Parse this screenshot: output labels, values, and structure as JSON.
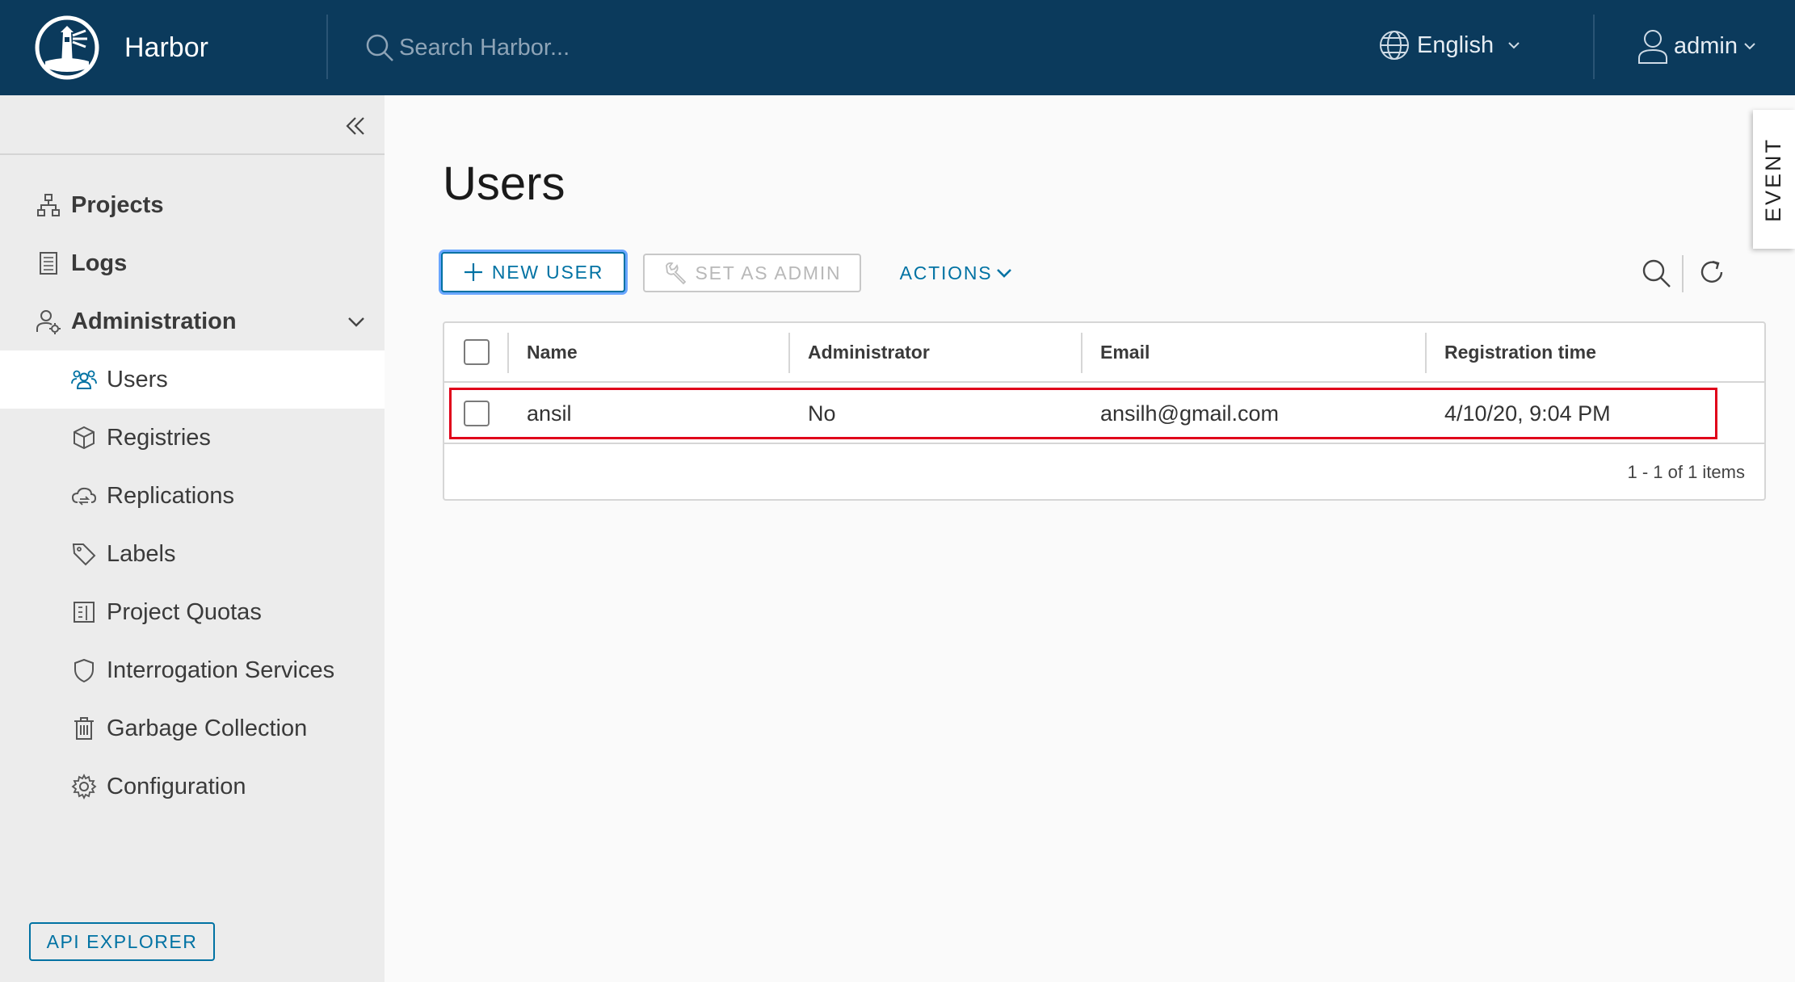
{
  "app": {
    "name": "Harbor"
  },
  "header": {
    "search_placeholder": "Search Harbor...",
    "language": "English",
    "user": "admin"
  },
  "sidebar": {
    "items": [
      {
        "label": "Projects",
        "icon": "projects-icon"
      },
      {
        "label": "Logs",
        "icon": "logs-icon"
      },
      {
        "label": "Administration",
        "icon": "administration-icon",
        "expanded": true
      }
    ],
    "sub_items": [
      {
        "label": "Users",
        "icon": "users-icon",
        "active": true
      },
      {
        "label": "Registries",
        "icon": "cube-icon"
      },
      {
        "label": "Replications",
        "icon": "cloud-sync-icon"
      },
      {
        "label": "Labels",
        "icon": "tag-icon"
      },
      {
        "label": "Project Quotas",
        "icon": "quota-icon"
      },
      {
        "label": "Interrogation Services",
        "icon": "shield-icon"
      },
      {
        "label": "Garbage Collection",
        "icon": "trash-icon"
      },
      {
        "label": "Configuration",
        "icon": "gear-icon"
      }
    ],
    "api_explorer": "API EXPLORER"
  },
  "main": {
    "title": "Users",
    "toolbar": {
      "new_user": "NEW USER",
      "set_as_admin": "SET AS ADMIN",
      "actions": "ACTIONS"
    },
    "event_tab": "EVENT",
    "table": {
      "columns": [
        "Name",
        "Administrator",
        "Email",
        "Registration time"
      ],
      "rows": [
        {
          "name": "ansil",
          "administrator": "No",
          "email": "ansilh@gmail.com",
          "registration_time": "4/10/20, 9:04 PM",
          "highlighted": true
        }
      ],
      "footer": "1 - 1 of 1 items"
    }
  },
  "colors": {
    "header_bg": "#0b3a5c",
    "accent": "#0072a3",
    "highlight": "#e0001a",
    "sidebar_bg": "#ececec"
  }
}
